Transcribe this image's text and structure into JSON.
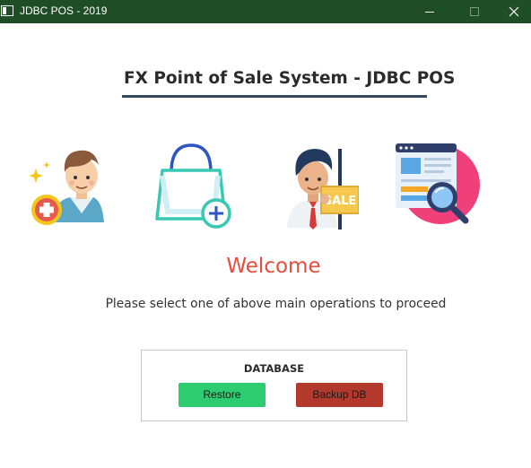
{
  "window": {
    "title": "JDBC POS - 2019",
    "controls": [
      "minimize",
      "maximize",
      "close"
    ]
  },
  "header": {
    "title": "FX Point of Sale System - JDBC POS"
  },
  "operations": [
    {
      "icon": "add-customer-icon"
    },
    {
      "icon": "add-product-bag-icon"
    },
    {
      "icon": "sales-person-icon"
    },
    {
      "icon": "search-report-icon"
    }
  ],
  "main": {
    "welcome": "Welcome",
    "instruction": "Please select one of above main operations to proceed"
  },
  "database": {
    "title": "DATABASE",
    "restore_label": "Restore",
    "backup_label": "Backup DB"
  },
  "colors": {
    "titlebar": "#1f4d26",
    "heading_underline": "#34495e",
    "welcome": "#e74c3c",
    "restore_button": "#2ecc71",
    "backup_button": "#b3392c"
  }
}
